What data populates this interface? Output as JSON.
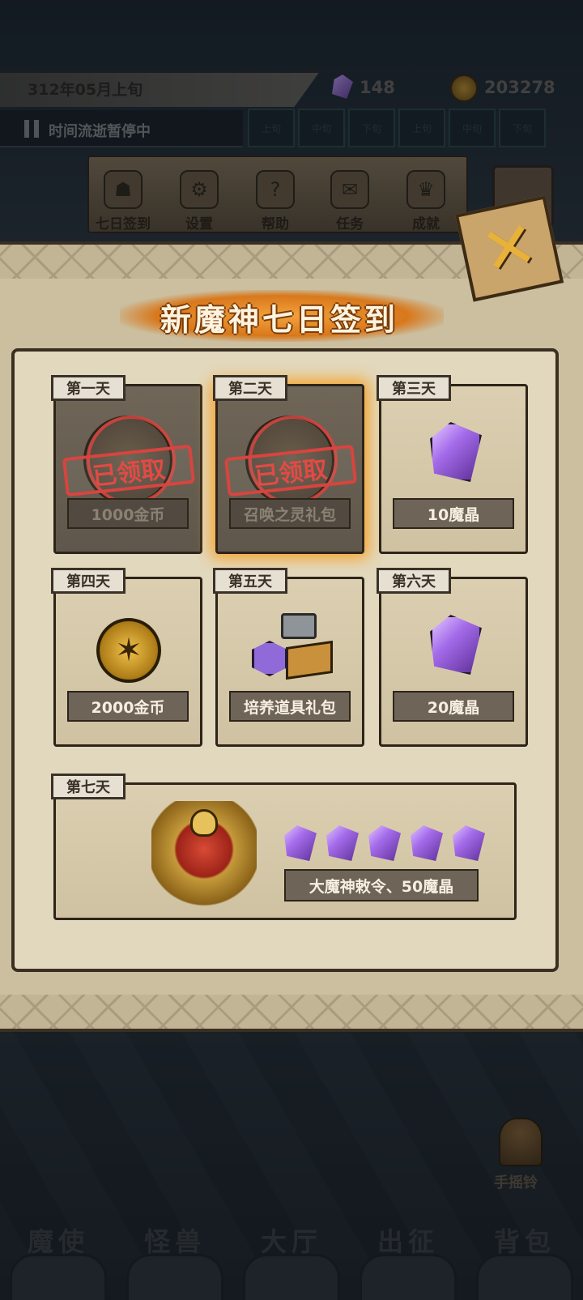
{
  "header": {
    "date": "312年05月上旬",
    "gems": "148",
    "coins": "203278",
    "pause_text": "时间流逝暂停中",
    "time_cells": [
      "上旬",
      "中旬",
      "下旬",
      "上旬",
      "中旬",
      "下旬"
    ]
  },
  "menu": [
    {
      "label": "七日签到",
      "icon": "calendar-icon"
    },
    {
      "label": "设置",
      "icon": "gear-icon"
    },
    {
      "label": "帮助",
      "icon": "help-icon"
    },
    {
      "label": "任务",
      "icon": "task-icon"
    },
    {
      "label": "成就",
      "icon": "trophy-icon"
    }
  ],
  "popup": {
    "title": "新魔神七日签到",
    "claimed_stamp": "已领取",
    "days": [
      {
        "day": "第一天",
        "reward": "1000金币",
        "status": "claimed",
        "icon": "coin-icon"
      },
      {
        "day": "第二天",
        "reward": "召唤之灵礼包",
        "status": "claimed",
        "icon": "summon-pack-icon"
      },
      {
        "day": "第三天",
        "reward": "10魔晶",
        "status": "available",
        "icon": "gem-icon"
      },
      {
        "day": "第四天",
        "reward": "2000金币",
        "status": "locked",
        "icon": "coin-icon"
      },
      {
        "day": "第五天",
        "reward": "培养道具礼包",
        "status": "locked",
        "icon": "item-pack-icon"
      },
      {
        "day": "第六天",
        "reward": "20魔晶",
        "status": "locked",
        "icon": "gem-icon"
      }
    ],
    "day7": {
      "day": "第七天",
      "reward": "大魔神敕令、50魔晶",
      "icon": "demon-emblem-icon"
    }
  },
  "bell_label": "手摇铃",
  "bottom_nav": [
    "魔使",
    "怪兽",
    "大厅",
    "出征",
    "背包"
  ]
}
